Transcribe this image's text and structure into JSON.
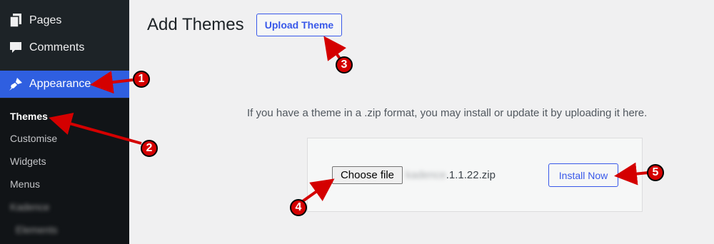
{
  "sidebar": {
    "menu": [
      {
        "label": "Pages",
        "icon": "pages-icon"
      },
      {
        "label": "Comments",
        "icon": "comments-icon"
      },
      {
        "label": "Appearance",
        "icon": "paintbrush-icon"
      }
    ],
    "submenu": [
      {
        "label": "Themes"
      },
      {
        "label": "Customise"
      },
      {
        "label": "Widgets"
      },
      {
        "label": "Menus"
      },
      {
        "label": "Kadence"
      },
      {
        "label": "Elements"
      }
    ]
  },
  "main": {
    "title": "Add Themes",
    "upload_theme_label": "Upload Theme",
    "help_text": "If you have a theme in a .zip format, you may install or update it by uploading it here.",
    "choose_file_label": "Choose file",
    "file_name_blurred": "kadence",
    "file_name_suffix": ".1.1.22.zip",
    "install_label": "Install Now"
  },
  "callouts": [
    "1",
    "2",
    "3",
    "4",
    "5"
  ],
  "colors": {
    "sidebar_bg": "#1d2327",
    "active_bg": "#2f5fe0",
    "accent": "#3858e9",
    "callout_red": "#d40000"
  }
}
